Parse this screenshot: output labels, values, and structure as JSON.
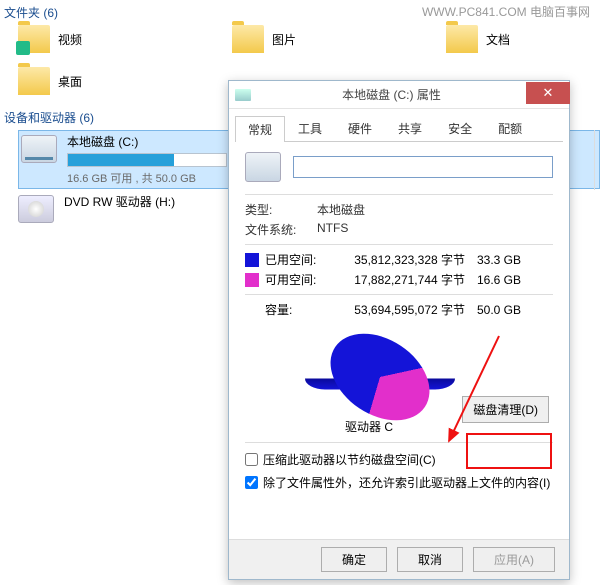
{
  "watermark": "WWW.PC841.COM 电脑百事网",
  "folders_header": "文件夹 (6)",
  "folders": [
    {
      "label": "视频"
    },
    {
      "label": "图片"
    },
    {
      "label": "文档"
    },
    {
      "label": "桌面"
    }
  ],
  "devices_header": "设备和驱动器 (6)",
  "drives": {
    "c": {
      "name": "本地磁盘 (C:)",
      "sub": "16.6 GB 可用 , 共 50.0 GB",
      "fill_pct": 67
    },
    "dvd": {
      "name": "DVD RW 驱动器 (H:)"
    }
  },
  "dialog": {
    "title": "本地磁盘 (C:) 属性",
    "close": "✕",
    "tabs": [
      "常规",
      "工具",
      "硬件",
      "共享",
      "安全",
      "配额"
    ],
    "name_value": "",
    "type_label": "类型:",
    "type_value": "本地磁盘",
    "fs_label": "文件系统:",
    "fs_value": "NTFS",
    "used_label": "已用空间:",
    "used_bytes": "35,812,323,328 字节",
    "used_gb": "33.3 GB",
    "free_label": "可用空间:",
    "free_bytes": "17,882,271,744 字节",
    "free_gb": "16.6 GB",
    "cap_label": "容量:",
    "cap_bytes": "53,694,595,072 字节",
    "cap_gb": "50.0 GB",
    "drive_c_text": "驱动器 C",
    "cleanup_btn": "磁盘清理(D)",
    "compress_check": "压缩此驱动器以节约磁盘空间(C)",
    "index_check": "除了文件属性外，还允许索引此驱动器上文件的内容(I)",
    "ok": "确定",
    "cancel": "取消",
    "apply": "应用(A)"
  },
  "chart_data": {
    "type": "pie",
    "title": "驱动器 C",
    "series": [
      {
        "name": "已用空间",
        "value": 33.3,
        "color": "#1414d8"
      },
      {
        "name": "可用空间",
        "value": 16.6,
        "color": "#e22fcb"
      }
    ],
    "unit": "GB",
    "total": 50.0
  }
}
